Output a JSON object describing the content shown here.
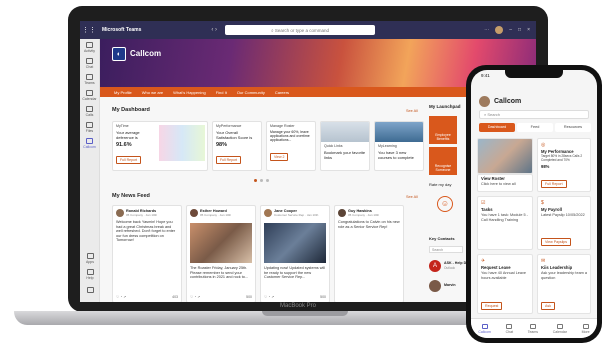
{
  "laptop": {
    "brand": "MacBook Pro",
    "topbar": {
      "app_name": "Microsoft Teams",
      "nav_arrows": "‹ ›",
      "search_placeholder": "Search or type a command"
    },
    "rail": [
      {
        "icon": "activity-icon",
        "label": "Activity"
      },
      {
        "icon": "chat-icon",
        "label": "Chat"
      },
      {
        "icon": "teams-icon",
        "label": "Teams"
      },
      {
        "icon": "calendar-icon",
        "label": "Calendar"
      },
      {
        "icon": "calls-icon",
        "label": "Calls"
      },
      {
        "icon": "files-icon",
        "label": "Files"
      },
      {
        "icon": "callcom-icon",
        "label": "Callcom"
      }
    ],
    "rail_bottom": [
      {
        "icon": "apps-icon",
        "label": "Apps"
      },
      {
        "icon": "help-icon",
        "label": "Help"
      },
      {
        "icon": "download-icon",
        "label": ""
      }
    ],
    "hero": {
      "logo_text": "Callcom"
    },
    "nav": [
      "My Profile",
      "Who we are",
      "What's Happening",
      "Find It",
      "Our Community",
      "Careers"
    ],
    "nav_right": "Internal",
    "dashboard": {
      "title": "My Dashboard",
      "see_all": "See All",
      "cards": [
        {
          "title": "MyTime",
          "body": "Your average deference is",
          "value": "91.6%",
          "button": "Full Report"
        },
        {
          "title": "MyPerformance",
          "body": "Your Overall Satisfaction Score is",
          "value": "98%",
          "button": "Full Report"
        },
        {
          "title": "Manage Roster",
          "body": "Manage your 60%, leave applications and overtime applications...",
          "value": "",
          "button": "View 2"
        },
        {
          "title": "Quick Links",
          "body": "Bookmark your favorite links",
          "value": "",
          "button": ""
        },
        {
          "title": "MyLearning",
          "body": "You have 3 new courses to complete",
          "value": "",
          "button": ""
        }
      ]
    },
    "news": {
      "title": "My News Feed",
      "see_all": "See All",
      "posts": [
        {
          "name": "Ronald Richards",
          "sub": "05 Company · Jan 10th",
          "text": "Welcome back Yasmin! Hope you had a great Christmas break and well refreshed. Don't forget to enter our fun dress competition on Tomorrow!",
          "foot": "403"
        },
        {
          "name": "Esther Howard",
          "sub": "05 Company · Jan 10th",
          "text": "The Roaster   Friday, January 25th. Please remember to send your contributions in 2021 and rock to...",
          "foot": "500"
        },
        {
          "name": "Jane Cooper",
          "sub": "Customer Service Rep · Jan 10th",
          "text": "Updating now! Updated systems will be ready to support the new Customer Service Rep...",
          "foot": "500"
        },
        {
          "name": "Guy Hawkins",
          "sub": "05 Company · Jan 10th",
          "text": "Congratulations to Calvin on his new role as a Senior Service Rep!",
          "foot": ""
        }
      ]
    },
    "launchpad": {
      "title": "My Launchpad",
      "tiles": [
        "Employee Benefits",
        "Recognise Someone"
      ],
      "rate": "Rate my day",
      "contacts": "Key Contacts",
      "contacts_search": "Search",
      "contact_name": "ASK - Help Desk",
      "contact_sub": "Outlook",
      "contact_initial": "A",
      "contact2": "Marvin"
    }
  },
  "phone": {
    "status_time": "9:41",
    "title": "Callcom",
    "search_placeholder": "Search",
    "tabs": [
      "Dashboard",
      "Feed",
      "Resources"
    ],
    "cards": [
      {
        "title": "",
        "sub": "",
        "button": ""
      },
      {
        "title": "My Performance",
        "sub": "Target 80% in 28secs Calls 2 Completed and 70%",
        "value": "98%",
        "button": "Full Report"
      },
      {
        "title": "View Roster",
        "sub": "Click here to view all",
        "button": ""
      },
      {
        "title": "Tasks",
        "sub": "You have 1 task: Module 5 - Call Handling Training",
        "button": ""
      },
      {
        "title": "My Payroll",
        "sub": "Latest Payslip 10/05/2022",
        "button": "View Payslips"
      },
      {
        "title": "Request Leave",
        "sub": "You have 40 Annual Leave hours available",
        "button": "Request"
      },
      {
        "title": "Kiis Leadership",
        "sub": "Ask your leadership team a question",
        "button": "Ask"
      }
    ],
    "bottom_nav": [
      "Callcom",
      "Chat",
      "Teams",
      "Calendar",
      "More"
    ]
  },
  "colors": {
    "accent": "#d9581c",
    "teams": "#2f2f55",
    "brand_purple": "#5b5fc7"
  }
}
